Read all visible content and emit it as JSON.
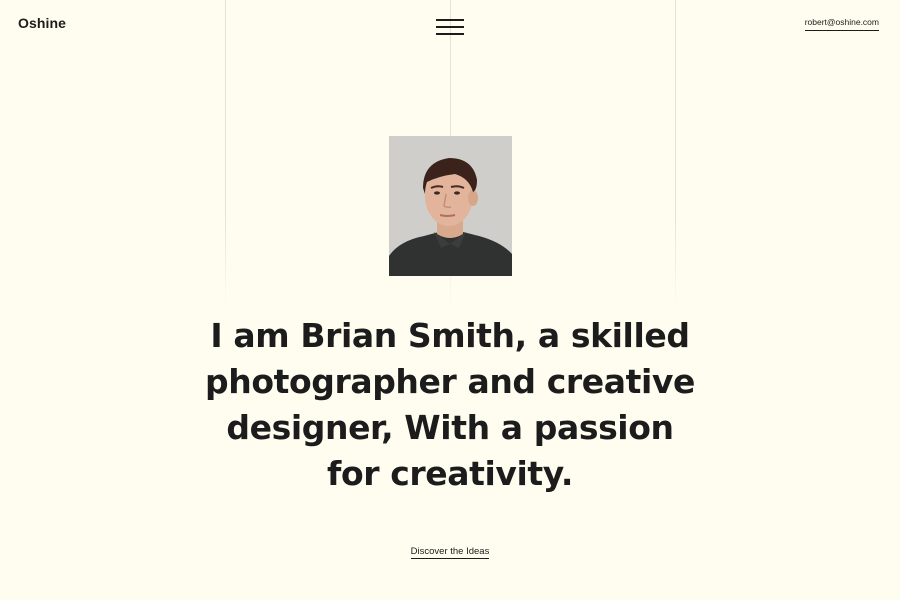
{
  "header": {
    "logo": "Oshine",
    "email": "robert@oshine.com"
  },
  "hero": {
    "headline": "I am Brian Smith, a skilled photographer and creative designer, With a passion for creativity.",
    "cta_label": "Discover the Ideas"
  },
  "icons": {
    "menu": "hamburger-menu-icon"
  },
  "colors": {
    "background": "#fefdf0",
    "text": "#1c1c1c"
  }
}
